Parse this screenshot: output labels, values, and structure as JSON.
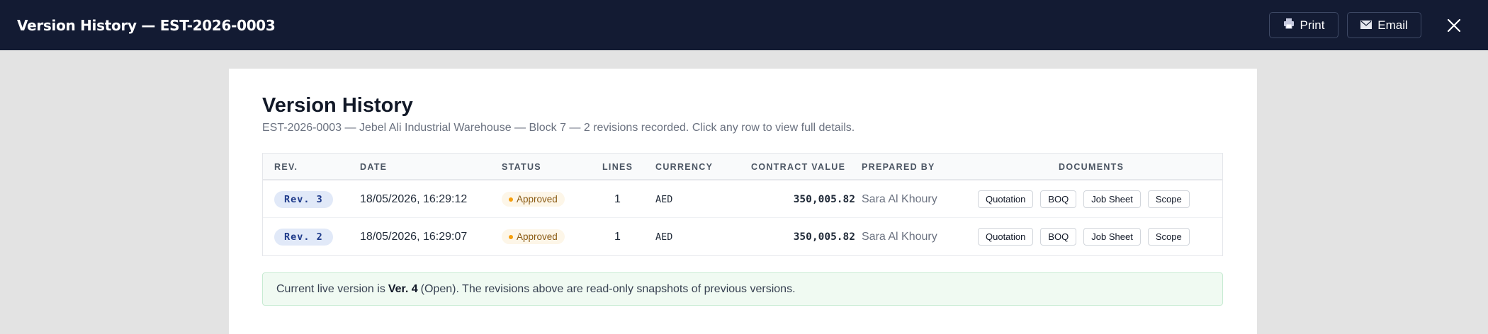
{
  "header": {
    "title": "Version History — EST-2026-0003",
    "print_label": "Print",
    "email_label": "Email"
  },
  "card": {
    "title": "Version History",
    "subtitle": "EST-2026-0003 — Jebel Ali Industrial Warehouse — Block 7 — 2 revisions recorded. Click any row to view full details."
  },
  "table": {
    "columns": {
      "rev": "REV.",
      "date": "DATE",
      "status": "STATUS",
      "lines": "LINES",
      "currency": "CURRENCY",
      "contract_value": "CONTRACT VALUE",
      "prepared_by": "PREPARED BY",
      "documents": "DOCUMENTS"
    },
    "rows": [
      {
        "rev": "Rev. 3",
        "date": "18/05/2026, 16:29:12",
        "status": "Approved",
        "lines": "1",
        "currency": "AED",
        "contract_value": "350,005.82",
        "prepared_by": "Sara Al Khoury",
        "docs": [
          "Quotation",
          "BOQ",
          "Job Sheet",
          "Scope"
        ]
      },
      {
        "rev": "Rev. 2",
        "date": "18/05/2026, 16:29:07",
        "status": "Approved",
        "lines": "1",
        "currency": "AED",
        "contract_value": "350,005.82",
        "prepared_by": "Sara Al Khoury",
        "docs": [
          "Quotation",
          "BOQ",
          "Job Sheet",
          "Scope"
        ]
      }
    ]
  },
  "note": {
    "prefix": "Current live version is",
    "version": "Ver. 4",
    "suffix": "(Open). The revisions above are read-only snapshots of previous versions."
  },
  "icons": {
    "print": "printer-icon",
    "email": "envelope-icon",
    "close": "close-icon"
  },
  "colors": {
    "topbar": "#131b33",
    "status_dot": "#f59e0b",
    "rev_pill": "#e1e9f8",
    "note_bg": "#f0faf2"
  }
}
